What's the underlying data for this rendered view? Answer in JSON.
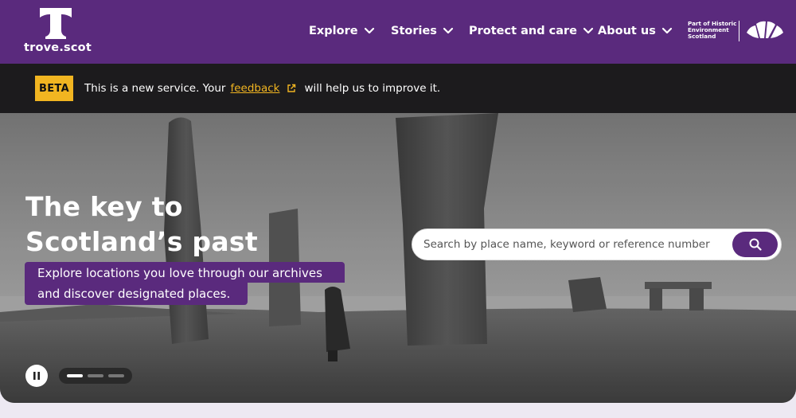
{
  "brand": {
    "name": "trove.scot",
    "partner_lines": [
      "Part of Historic",
      "Environment",
      "Scotland"
    ]
  },
  "nav": {
    "items": [
      {
        "label": "Explore"
      },
      {
        "label": "Stories"
      },
      {
        "label": "Protect and care"
      },
      {
        "label": "About us"
      }
    ]
  },
  "beta": {
    "tag": "BETA",
    "message_before": "This is a new service. Your",
    "link_label": "feedback",
    "message_after": "will help us to improve it."
  },
  "hero": {
    "title_line1": "The key to",
    "title_line2": "Scotland’s past",
    "subtitle_line1": "Explore locations you love through our archives",
    "subtitle_line2": "and discover designated places."
  },
  "search": {
    "placeholder": "Search by place name, keyword or reference number",
    "value": ""
  },
  "carousel": {
    "slide_count": 3,
    "active_slide": 1
  },
  "colors": {
    "brand_purple": "#5a2a7d",
    "banner_dark": "#1c1b1d",
    "beta_yellow": "#f1b521",
    "page_bg": "#ede9f2"
  },
  "icons": {
    "logo": "trove-t-logo",
    "nav_chevron": "chevron-down-icon",
    "external": "external-link-icon",
    "search": "search-icon",
    "pause": "pause-icon",
    "partner": "hes-fan-logo"
  }
}
